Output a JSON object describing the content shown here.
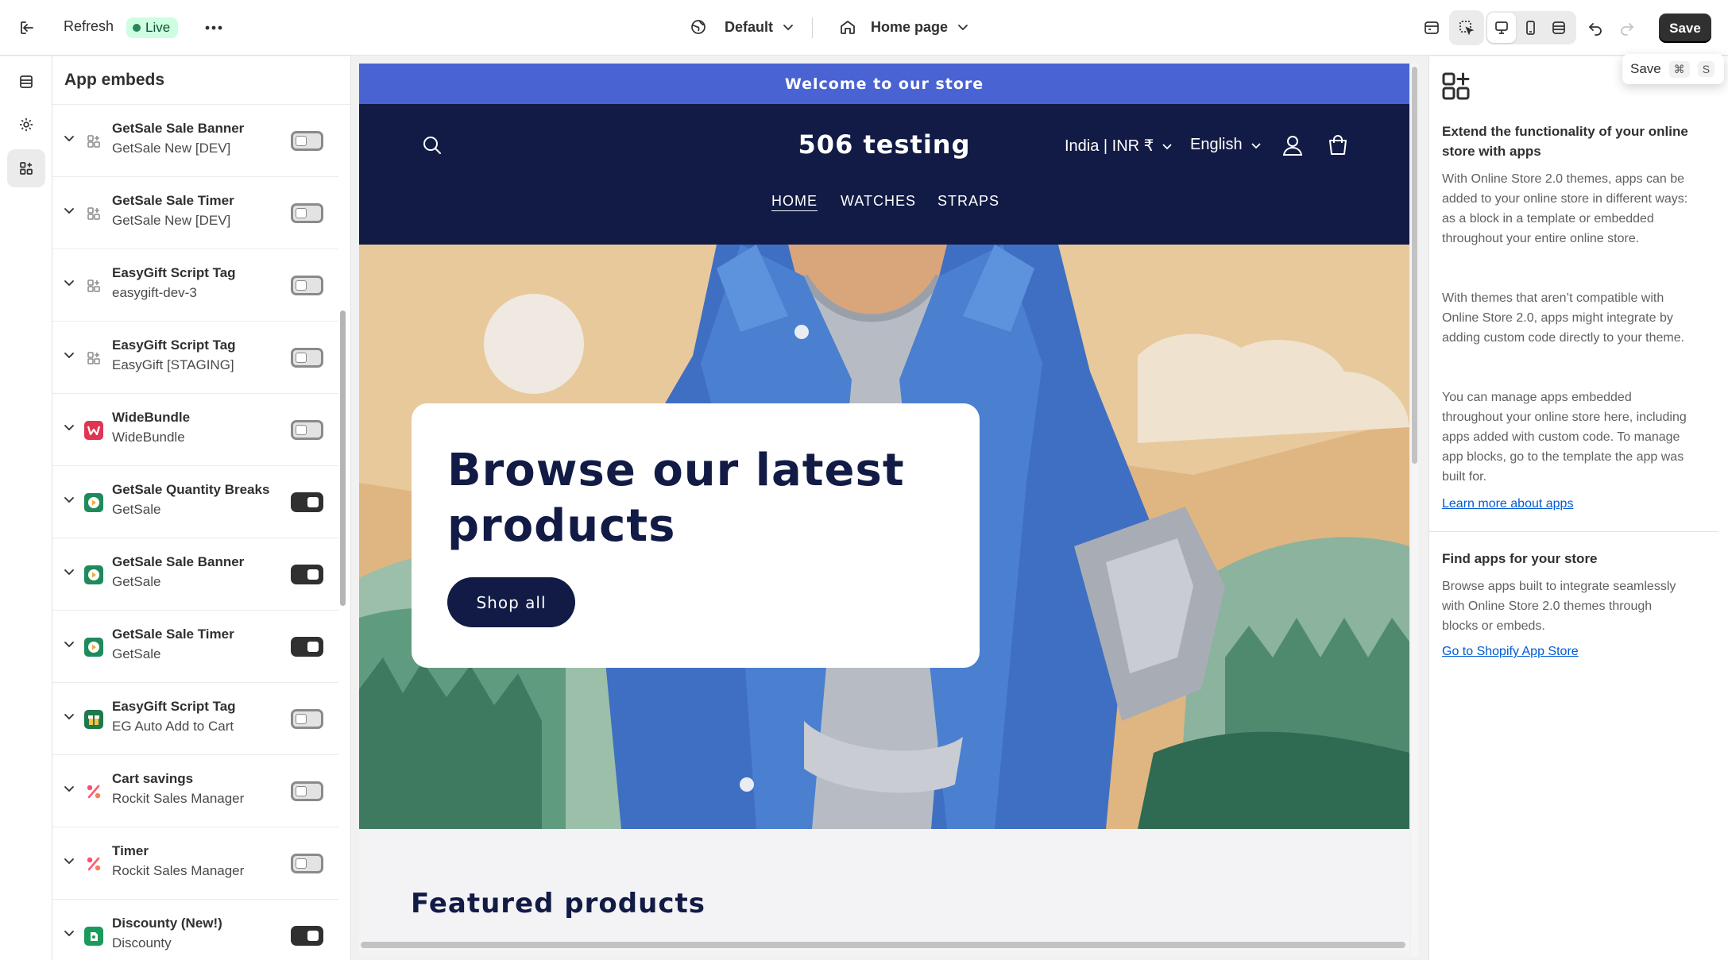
{
  "topbar": {
    "refresh_label": "Refresh",
    "live_label": "Live",
    "theme_label": "Default",
    "page_label": "Home page",
    "save_label": "Save",
    "tooltip": {
      "label": "Save",
      "key1": "⌘",
      "key2": "S"
    }
  },
  "sidebar": {
    "title": "App embeds",
    "items": [
      {
        "name": "GetSale Sale Banner",
        "sub": "GetSale New [DEV]",
        "icon": "app-placeholder-icon",
        "on": false
      },
      {
        "name": "GetSale Sale Timer",
        "sub": "GetSale New [DEV]",
        "icon": "app-placeholder-icon",
        "on": false
      },
      {
        "name": "EasyGift Script Tag",
        "sub": "easygift-dev-3",
        "icon": "app-placeholder-icon",
        "on": false
      },
      {
        "name": "EasyGift Script Tag",
        "sub": "EasyGift [STAGING]",
        "icon": "app-placeholder-icon",
        "on": false
      },
      {
        "name": "WideBundle",
        "sub": "WideBundle",
        "icon": "widebundle-icon",
        "on": false
      },
      {
        "name": "GetSale Quantity Breaks",
        "sub": "GetSale",
        "icon": "getsale-icon",
        "on": true
      },
      {
        "name": "GetSale Sale Banner",
        "sub": "GetSale",
        "icon": "getsale-icon",
        "on": true
      },
      {
        "name": "GetSale Sale Timer",
        "sub": "GetSale",
        "icon": "getsale-icon",
        "on": true
      },
      {
        "name": "EasyGift Script Tag",
        "sub": "EG Auto Add to Cart",
        "icon": "gift-icon",
        "on": false
      },
      {
        "name": "Cart savings",
        "sub": "Rockit Sales Manager",
        "icon": "percent-icon",
        "on": false
      },
      {
        "name": "Timer",
        "sub": "Rockit Sales Manager",
        "icon": "percent-icon",
        "on": false
      },
      {
        "name": "Discounty (New!)",
        "sub": "Discounty",
        "icon": "discounty-icon",
        "on": true
      }
    ]
  },
  "preview": {
    "announcement": "Welcome to our store",
    "store_name": "506 testing",
    "currency": "India | INR ₹",
    "language": "English",
    "nav": [
      "HOME",
      "WATCHES",
      "STRAPS"
    ],
    "hero_title": "Browse our latest products",
    "hero_button": "Shop all",
    "featured_title": "Featured products"
  },
  "rpanel": {
    "heading1": "Extend the functionality of your online store with apps",
    "para1": "With Online Store 2.0 themes, apps can be added to your online store in different ways: as a block in a template or embedded throughout your entire online store.",
    "para2": "With themes that aren’t compatible with Online Store 2.0, apps might integrate by adding custom code directly to your theme.",
    "para3": "You can manage apps embedded throughout your online store here, including apps added with custom code. To manage app blocks, go to the template the app was built for.",
    "link1": "Learn more about apps",
    "heading2": "Find apps for your store",
    "para4": "Browse apps built to integrate seamlessly with Online Store 2.0 themes through blocks or embeds.",
    "link2": "Go to Shopify App Store"
  },
  "colors": {
    "announcement_bg": "#4a63d3",
    "header_bg": "#121b45",
    "live_badge_bg": "#cdfee1",
    "save_bg": "#303030",
    "link": "#005bd3"
  }
}
